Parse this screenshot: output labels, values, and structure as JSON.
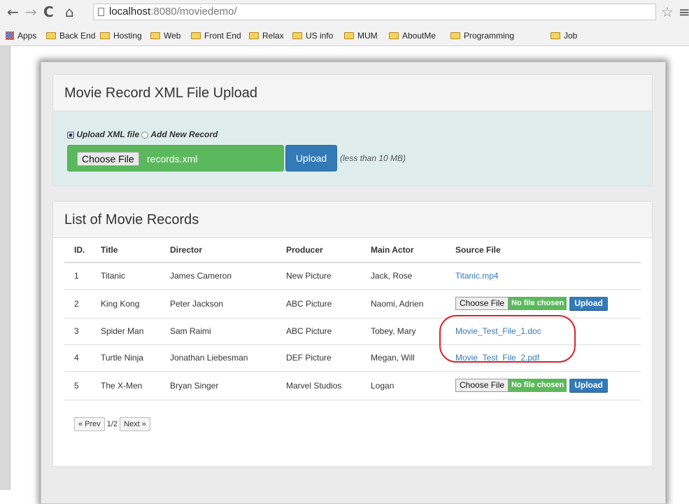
{
  "browser": {
    "url_host": "localhost",
    "url_path": ":8080/moviedemo/",
    "bookmarks": [
      "Apps",
      "Back End",
      "Hosting",
      "Web",
      "Front End",
      "Relax",
      "US info",
      "MUM",
      "AboutMe",
      "Programming",
      "Job"
    ]
  },
  "upload_panel": {
    "title": "Movie Record XML File Upload",
    "option_upload": "Upload XML file",
    "option_add": "Add New Record",
    "choose_label": "Choose File",
    "file_name": "records.xml",
    "upload_label": "Upload",
    "size_note": "(less than 10 MB)"
  },
  "records_panel": {
    "title": "List of Movie Records",
    "columns": [
      "ID.",
      "Title",
      "Director",
      "Producer",
      "Main Actor",
      "Source File"
    ],
    "rows": [
      {
        "id": "1",
        "title": "Titanic",
        "director": "James Cameron",
        "producer": "New Picture",
        "actor": "Jack, Rose",
        "source": "Titanic.mp4"
      },
      {
        "id": "2",
        "title": "King Kong",
        "director": "Peter Jackson",
        "producer": "ABC Picture",
        "actor": "Naomi, Adrien",
        "source": ""
      },
      {
        "id": "3",
        "title": "Spider Man",
        "director": "Sam Raimi",
        "producer": "ABC Picture",
        "actor": "Tobey, Mary",
        "source": "Movie_Test_File_1.doc"
      },
      {
        "id": "4",
        "title": "Turtle Ninja",
        "director": "Jonathan Liebesman",
        "producer": "DEF Picture",
        "actor": "Megan, Will",
        "source": "Movie_Test_File_2.pdf"
      },
      {
        "id": "5",
        "title": "The X-Men",
        "director": "Bryan Singer",
        "producer": "Marvel Studios",
        "actor": "Logan",
        "source": ""
      }
    ],
    "row_upload": {
      "choose": "Choose File",
      "status": "No file chosen",
      "upload": "Upload"
    },
    "pager": {
      "prev": "« Prev",
      "page": "1/2",
      "next": "Next »"
    }
  }
}
